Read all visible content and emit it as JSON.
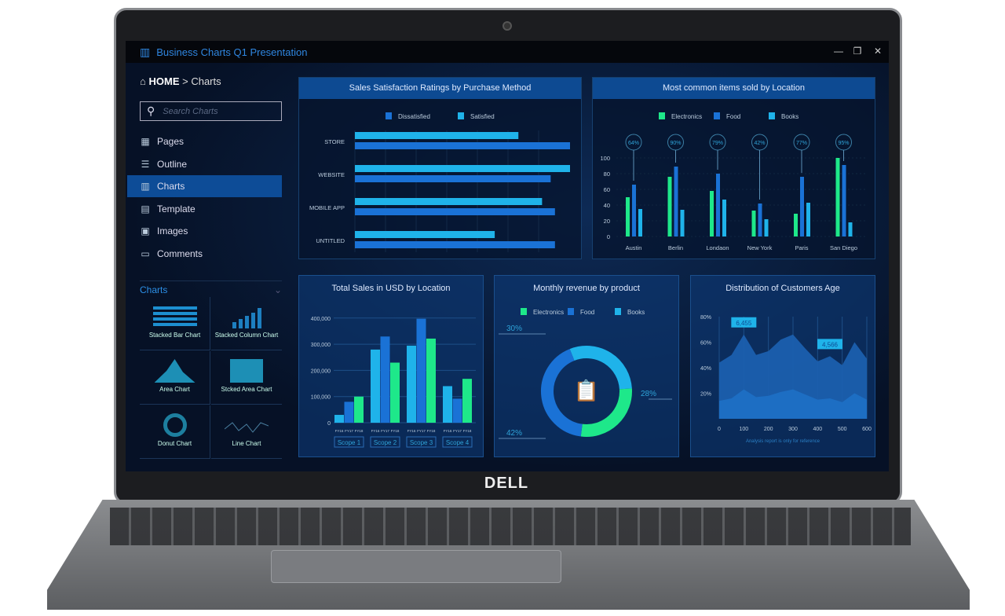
{
  "window": {
    "title": "Business Charts Q1 Presentation",
    "minimize": "—",
    "restore": "❐",
    "close": "✕"
  },
  "breadcrumb": {
    "home": "HOME",
    "separator": ">",
    "current": "Charts"
  },
  "search": {
    "placeholder": "Search Charts",
    "value": ""
  },
  "nav": [
    {
      "label": "Pages",
      "icon": "grid-icon",
      "glyph": "▦"
    },
    {
      "label": "Outline",
      "icon": "list-icon",
      "glyph": "☰"
    },
    {
      "label": "Charts",
      "icon": "bar-chart-icon",
      "glyph": "▥",
      "active": true
    },
    {
      "label": "Template",
      "icon": "template-icon",
      "glyph": "▤"
    },
    {
      "label": "Images",
      "icon": "image-icon",
      "glyph": "▣"
    },
    {
      "label": "Comments",
      "icon": "comment-icon",
      "glyph": "▭"
    }
  ],
  "charts_section": {
    "title": "Charts",
    "tiles": [
      "Stacked Bar Chart",
      "Stacked Column Chart",
      "Area Chart",
      "Stcked Area Chart",
      "Donut Chart",
      "Line Chart"
    ]
  },
  "brand": "DELL",
  "colors": {
    "green": "#1ee88a",
    "blue": "#1a72d6",
    "cyan": "#1fb3ea",
    "accent": "#2f86e0"
  },
  "chart_data": [
    {
      "type": "bar",
      "orientation": "horizontal",
      "title": "Sales Satisfaction Ratings by Purchase Method",
      "categories": [
        "STORE",
        "WEBSITE",
        "MOBILE APP",
        "UNTITLED"
      ],
      "series": [
        {
          "name": "Dissatisfied",
          "values": [
            100,
            91,
            93,
            93
          ]
        },
        {
          "name": "Satisfied",
          "values": [
            76,
            100,
            87,
            65
          ]
        }
      ],
      "legend": "top",
      "grid": true
    },
    {
      "type": "bar",
      "title": "Most common items sold by Location",
      "categories": [
        "Austin",
        "Berlin",
        "Londaon",
        "New York",
        "Paris",
        "San Diego"
      ],
      "series": [
        {
          "name": "Electronics",
          "values": [
            50,
            76,
            58,
            33,
            29,
            100
          ]
        },
        {
          "name": "Food",
          "values": [
            66,
            89,
            80,
            42,
            76,
            91
          ]
        },
        {
          "name": "Books",
          "values": [
            35,
            34,
            47,
            22,
            43,
            18
          ]
        }
      ],
      "annotations": [
        "64%",
        "90%",
        "79%",
        "42%",
        "77%",
        "95%"
      ],
      "yticks": [
        "0",
        "20",
        "40",
        "60",
        "80",
        "100"
      ],
      "ylim": [
        0,
        100
      ],
      "legend": "top"
    },
    {
      "type": "bar",
      "title": "Total Sales in USD by Location",
      "groups": [
        "Scope 1",
        "Scope 2",
        "Scope 3",
        "Scope 4"
      ],
      "subcategories": [
        "FY16",
        "FY17",
        "FY18"
      ],
      "values": [
        [
          30000,
          80000,
          100000
        ],
        [
          280000,
          330000,
          230000
        ],
        [
          295000,
          398000,
          322000
        ],
        [
          140000,
          92000,
          168000
        ]
      ],
      "yticks": [
        "0",
        "100,000",
        "200,000",
        "300,000",
        "400,000"
      ],
      "ylim": [
        0,
        400000
      ]
    },
    {
      "type": "pie",
      "donut": true,
      "title": "Monthly revenue by product",
      "legend_labels": [
        "Electronics",
        "Food",
        "Books"
      ],
      "slices": [
        {
          "name": "Books",
          "value": 30,
          "label": "30%"
        },
        {
          "name": "Electronics",
          "value": 28,
          "label": "28%"
        },
        {
          "name": "Food",
          "value": 42,
          "label": "42%"
        }
      ],
      "legend": "top"
    },
    {
      "type": "area",
      "title": "Distribution of Customers Age",
      "x": [
        0,
        50,
        100,
        150,
        200,
        250,
        300,
        350,
        400,
        450,
        500,
        550,
        600
      ],
      "series": [
        {
          "values": [
            44,
            50,
            66,
            50,
            53,
            62,
            66,
            55,
            45,
            49,
            42,
            60,
            47
          ]
        },
        {
          "values": [
            14,
            16,
            23,
            17,
            18,
            21,
            23,
            19,
            15,
            16,
            13,
            20,
            15
          ]
        }
      ],
      "xticks": [
        "0",
        "100",
        "200",
        "300",
        "400",
        "500",
        "600"
      ],
      "yticks": [
        "20%",
        "40%",
        "60%",
        "80%"
      ],
      "ylim": [
        0,
        80
      ],
      "callouts": [
        "6,455",
        "4,566"
      ],
      "footnote": "Analysis report is only for reference"
    }
  ]
}
